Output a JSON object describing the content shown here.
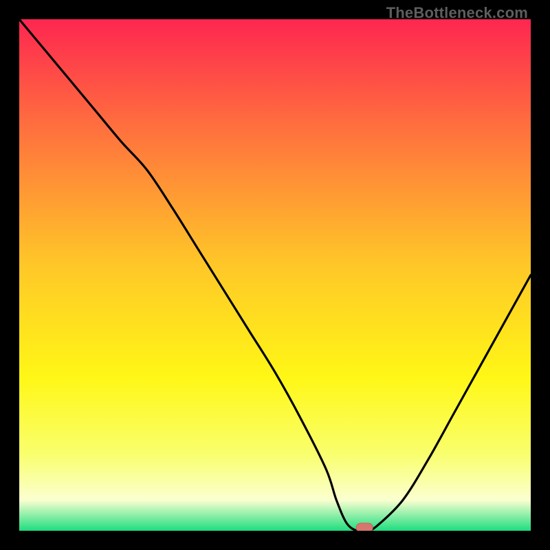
{
  "watermark": "TheBottleneck.com",
  "colors": {
    "frame": "#000000",
    "gradient_top": "#fe2650",
    "gradient_mid1": "#ff6c3f",
    "gradient_mid2": "#ffc728",
    "gradient_mid3": "#fff716",
    "gradient_mid4": "#f9ff6d",
    "gradient_pale": "#fbffd0",
    "gradient_bottom": "#1edd7f",
    "curve": "#000000",
    "marker_fill": "#d6766e",
    "marker_stroke": "#c95f58"
  },
  "chart_data": {
    "type": "line",
    "title": "",
    "xlabel": "",
    "ylabel": "",
    "xlim": [
      0,
      100
    ],
    "ylim": [
      0,
      100
    ],
    "x": [
      0,
      5,
      10,
      15,
      20,
      25,
      30,
      35,
      40,
      45,
      50,
      55,
      60,
      62,
      64,
      66,
      68,
      70,
      75,
      80,
      85,
      90,
      95,
      100
    ],
    "values": [
      100,
      94,
      88,
      82,
      76,
      70.5,
      63,
      55,
      47,
      39,
      31,
      22,
      12,
      6,
      1.5,
      0,
      0,
      1,
      6,
      14,
      23,
      32,
      41,
      50
    ],
    "marker": {
      "x": 67.5,
      "y": 0
    },
    "note": "x and y in percent of plot area; y=0 is bottom (green), y=100 is top (red)."
  }
}
